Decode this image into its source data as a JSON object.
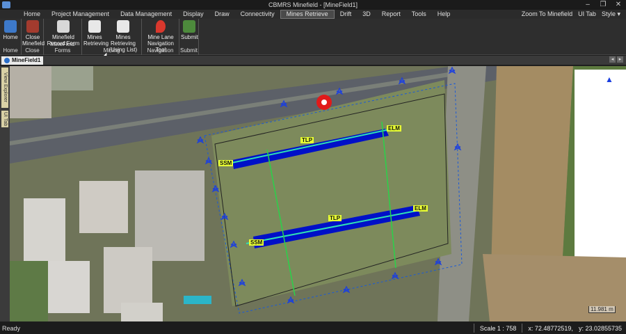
{
  "window": {
    "title": "CBMRS Minefield - [MineField1]"
  },
  "menu": {
    "items": [
      "Home",
      "Project Management",
      "Data Management",
      "Display",
      "Draw",
      "Connectivity",
      "Mines Retrieve",
      "Drift",
      "3D",
      "Report",
      "Tools",
      "Help"
    ],
    "active": "Mines Retrieve",
    "right": [
      "Zoom To Minefield",
      "UI Tab",
      "Style"
    ],
    "style_caret": "▾"
  },
  "ribbon": {
    "groups": [
      {
        "name": "Home",
        "buttons": [
          "Home"
        ]
      },
      {
        "name": "Close",
        "buttons": [
          "Close Minefield"
        ]
      },
      {
        "name": "MineField Forms",
        "buttons": [
          "Minefield Record Form"
        ]
      },
      {
        "name": "Mining",
        "buttons": [
          "Mines Retrieving",
          "Mines Retrieving (Using List)"
        ]
      },
      {
        "name": "Navigation",
        "buttons": [
          "Mine Lane Navigation Tool"
        ]
      },
      {
        "name": "Submit",
        "buttons": [
          "Submit"
        ]
      }
    ]
  },
  "doc_tab": {
    "label": "MineField1"
  },
  "side_tabs": [
    "View Explorer",
    "UI Tab"
  ],
  "map": {
    "lane_labels": [
      "SSM",
      "TLP",
      "ELM",
      "SSM",
      "TLP",
      "ELM"
    ],
    "scale_bar": "11.981 m",
    "north_arrow": "▲"
  },
  "status": {
    "ready": "Ready",
    "scale": "Scale 1 : 758",
    "x": "x: 72.48772519,",
    "y": "y: 23.02855735"
  },
  "colors": {
    "accent": "#1a5ad8",
    "lane": "#0010c8",
    "marker": "#e8ff33",
    "active_menu": "#4a4a4a"
  }
}
